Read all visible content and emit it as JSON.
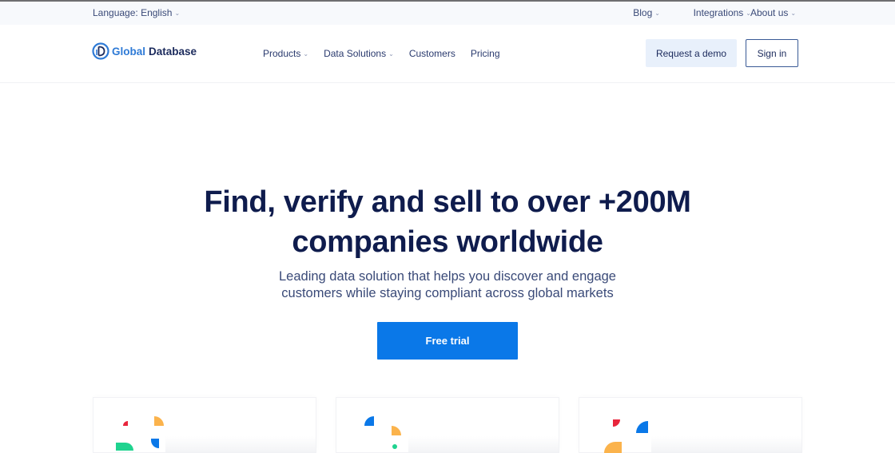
{
  "utility_bar": {
    "language_label": "Language:",
    "language_value": "English",
    "links": [
      {
        "label": "Blog"
      },
      {
        "label": "Integrations"
      },
      {
        "label": "About us"
      }
    ]
  },
  "header": {
    "logo": {
      "part1": "Global",
      "part2": "Database",
      "icon": "globe-d-logo-icon"
    },
    "nav": [
      {
        "label": "Products",
        "has_dropdown": true
      },
      {
        "label": "Data Solutions",
        "has_dropdown": true
      },
      {
        "label": "Customers",
        "has_dropdown": false
      },
      {
        "label": "Pricing",
        "has_dropdown": false
      }
    ],
    "request_demo_label": "Request a demo",
    "sign_in_label": "Sign in"
  },
  "hero": {
    "title_line1": "Find, verify and sell to over +200M",
    "title_line2": "companies worldwide",
    "subtitle_line1": "Leading data solution that helps you discover and engage",
    "subtitle_line2": "customers while staying compliant across global markets",
    "cta_label": "Free trial"
  },
  "colors": {
    "brand_blue": "#0a78e8",
    "navy": "#0f1c4d",
    "accent_red": "#e8253c",
    "accent_yellow": "#fbb34c",
    "accent_green": "#1fd38f"
  },
  "cards": [
    {
      "icon": "feature-illustration-1"
    },
    {
      "icon": "feature-illustration-2"
    },
    {
      "icon": "feature-illustration-3"
    }
  ]
}
